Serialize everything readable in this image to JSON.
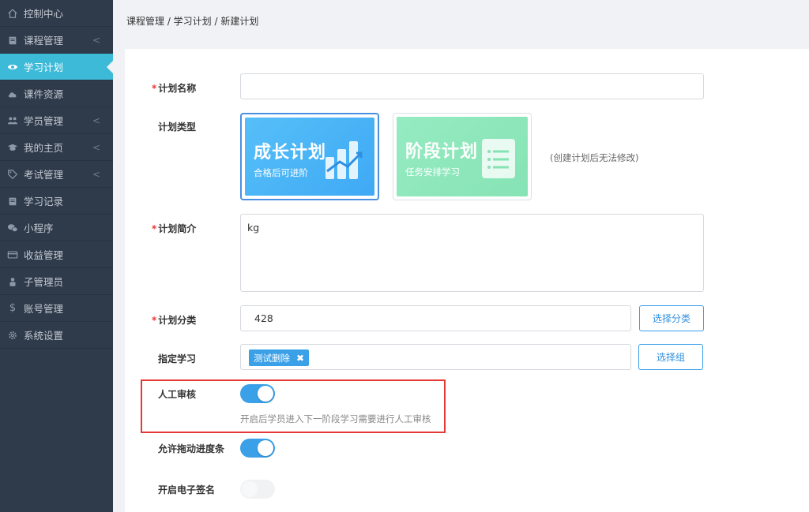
{
  "sidebar": {
    "items": [
      {
        "label": "控制中心",
        "icon": "home-icon",
        "chevron": false,
        "active": false
      },
      {
        "label": "课程管理",
        "icon": "book-icon",
        "chevron": true,
        "active": false
      },
      {
        "label": "学习计划",
        "icon": "eye-icon",
        "chevron": false,
        "active": true
      },
      {
        "label": "课件资源",
        "icon": "cloud-icon",
        "chevron": false,
        "active": false
      },
      {
        "label": "学员管理",
        "icon": "users-icon",
        "chevron": true,
        "active": false
      },
      {
        "label": "我的主页",
        "icon": "graduation-cap-icon",
        "chevron": true,
        "active": false
      },
      {
        "label": "考试管理",
        "icon": "tag-icon",
        "chevron": true,
        "active": false
      },
      {
        "label": "学习记录",
        "icon": "book-icon",
        "chevron": false,
        "active": false
      },
      {
        "label": "小程序",
        "icon": "wechat-icon",
        "chevron": false,
        "active": false
      },
      {
        "label": "收益管理",
        "icon": "credit-card-icon",
        "chevron": false,
        "active": false
      },
      {
        "label": "子管理员",
        "icon": "user-lock-icon",
        "chevron": false,
        "active": false
      },
      {
        "label": "账号管理",
        "icon": "dollar-icon",
        "chevron": false,
        "active": false
      },
      {
        "label": "系统设置",
        "icon": "gear-icon",
        "chevron": false,
        "active": false
      }
    ],
    "chevron_glyph": "<"
  },
  "breadcrumb": "课程管理 / 学习计划 / 新建计划",
  "form": {
    "required_mark": "*",
    "plan_name": {
      "label": "计划名称",
      "value": ""
    },
    "plan_type": {
      "label": "计划类型",
      "cards": [
        {
          "title": "成长计划",
          "subtitle": "合格后可进阶",
          "selected": true,
          "color": "#4fb6f7"
        },
        {
          "title": "阶段计划",
          "subtitle": "任务安排学习",
          "selected": false,
          "color": "#8fe6bb"
        }
      ],
      "note": "(创建计划后无法修改)"
    },
    "plan_intro": {
      "label": "计划简介",
      "value": "kg"
    },
    "plan_category": {
      "label": "计划分类",
      "value": "428",
      "button": "选择分类"
    },
    "assigned_study": {
      "label": "指定学习",
      "tag": "测试删除",
      "tag_remove": "✖",
      "button": "选择组"
    },
    "manual_review": {
      "label": "人工审核",
      "on": true,
      "hint": "开启后学员进入下一阶段学习需要进行人工审核"
    },
    "allow_drag": {
      "label": "允许拖动进度条",
      "on": true
    },
    "e_signature": {
      "label": "开启电子签名",
      "on": false
    }
  },
  "colors": {
    "sidebar_bg": "#2f3a4a",
    "active": "#3cbad8",
    "primary": "#3aa0e8",
    "highlight": "#e53935"
  }
}
